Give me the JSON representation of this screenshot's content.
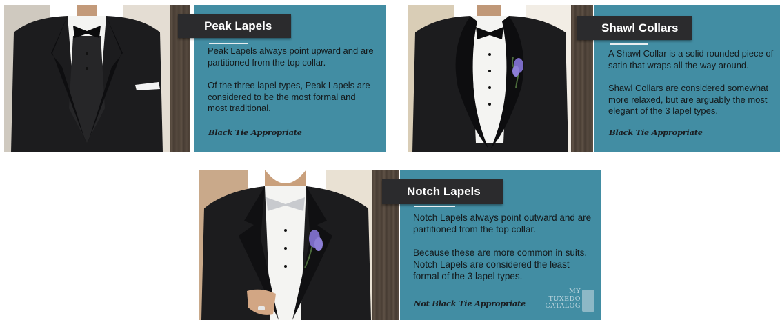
{
  "cards": [
    {
      "title": "Peak Lapels",
      "paragraphs": [
        "Peak Lapels always point upward and are partitioned from the top collar.",
        "Of the three lapel types, Peak Lapels are considered to be the most formal and most traditional."
      ],
      "note": "Black Tie Appropriate"
    },
    {
      "title": "Shawl Collars",
      "paragraphs": [
        "A Shawl Collar is a solid rounded piece of satin that wraps all the way around.",
        "Shawl Collars are considered somewhat more relaxed, but are arguably the most elegant of the 3 lapel types."
      ],
      "note": "Black Tie Appropriate"
    },
    {
      "title": "Notch Lapels",
      "paragraphs": [
        "Notch Lapels always point outward and are partitioned from the top collar.",
        "Because these are more common in suits, Notch Lapels are considered the least formal of the 3 lapel types."
      ],
      "note": "Not Black Tie Appropriate"
    }
  ],
  "logo": {
    "line1": "MY",
    "line2": "TUXEDO",
    "line3": "CATALOG"
  },
  "colors": {
    "panel": "#428da3",
    "tab": "#2b2b2d",
    "tuxedo": "#1c1c1e",
    "shirt": "#f4f4f2",
    "flower": "#7a6bc4"
  }
}
